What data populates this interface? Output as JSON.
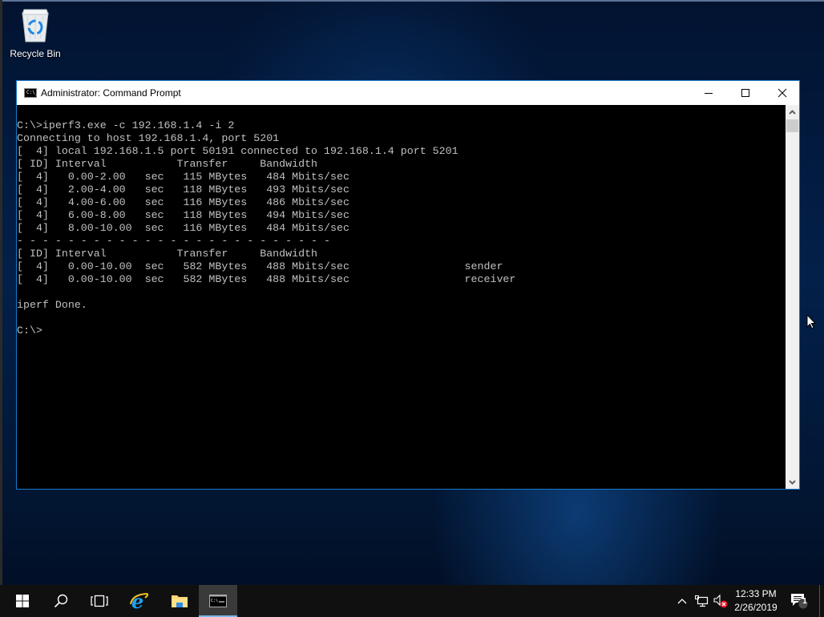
{
  "desktop": {
    "icons": [
      {
        "label": "Recycle Bin",
        "icon": "recycle-bin-icon"
      }
    ]
  },
  "window": {
    "title": "Administrator: Command Prompt",
    "icon": "command-prompt-icon",
    "icon_text": "C:\\_",
    "controls": {
      "minimize": "minimize-icon",
      "maximize": "maximize-icon",
      "close": "close-icon"
    },
    "console_lines": [
      "C:\\>iperf3.exe -c 192.168.1.4 -i 2",
      "Connecting to host 192.168.1.4, port 5201",
      "[  4] local 192.168.1.5 port 50191 connected to 192.168.1.4 port 5201",
      "[ ID] Interval           Transfer     Bandwidth",
      "[  4]   0.00-2.00   sec   115 MBytes   484 Mbits/sec",
      "[  4]   2.00-4.00   sec   118 MBytes   493 Mbits/sec",
      "[  4]   4.00-6.00   sec   116 MBytes   486 Mbits/sec",
      "[  4]   6.00-8.00   sec   118 MBytes   494 Mbits/sec",
      "[  4]   8.00-10.00  sec   116 MBytes   484 Mbits/sec",
      "- - - - - - - - - - - - - - - - - - - - - - - - -",
      "[ ID] Interval           Transfer     Bandwidth",
      "[  4]   0.00-10.00  sec   582 MBytes   488 Mbits/sec                  sender",
      "[  4]   0.00-10.00  sec   582 MBytes   488 Mbits/sec                  receiver",
      "",
      "iperf Done.",
      "",
      "C:\\>"
    ]
  },
  "taskbar": {
    "buttons": [
      {
        "name": "start",
        "icon": "windows-logo-icon"
      },
      {
        "name": "search",
        "icon": "search-icon"
      },
      {
        "name": "task-view",
        "icon": "task-view-icon"
      },
      {
        "name": "internet-explorer",
        "icon": "internet-explorer-icon"
      },
      {
        "name": "file-explorer",
        "icon": "file-explorer-icon"
      },
      {
        "name": "command-prompt",
        "icon": "command-prompt-icon",
        "active": true
      }
    ],
    "tray": {
      "icons": [
        "chevron-up-icon",
        "network-icon",
        "speaker-muted-icon"
      ],
      "time": "12:33 PM",
      "date": "2/26/2019",
      "notification_count": "1"
    }
  }
}
